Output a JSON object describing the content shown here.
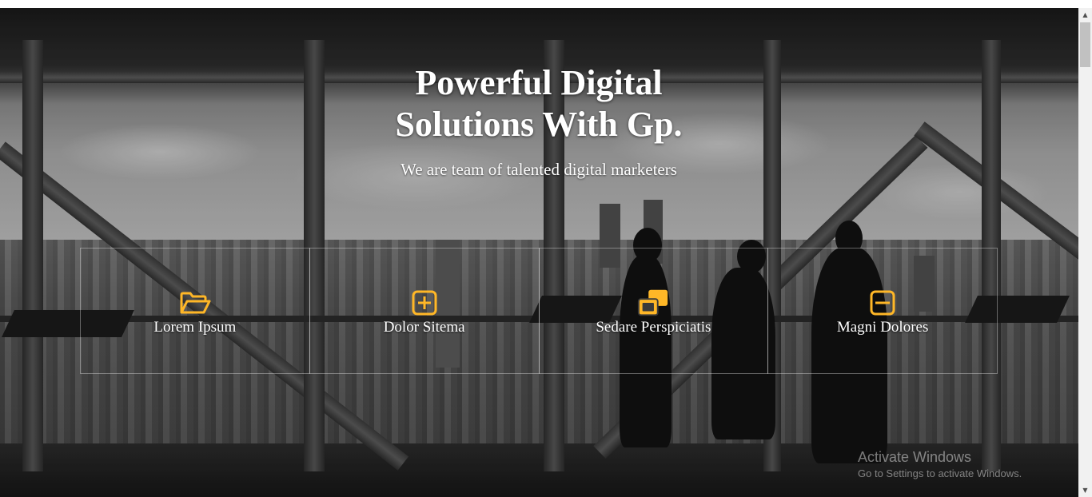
{
  "hero": {
    "title_line1": "Powerful Digital",
    "title_line2": "Solutions With Gp.",
    "subtitle": "We are team of talented digital marketers"
  },
  "features": [
    {
      "label": "Lorem Ipsum",
      "icon": "folder-open-icon"
    },
    {
      "label": "Dolor Sitema",
      "icon": "grid-plus-icon"
    },
    {
      "label": "Sedare Perspiciatis",
      "icon": "overlapping-squares-icon"
    },
    {
      "label": "Magni Dolores",
      "icon": "minus-square-icon"
    }
  ],
  "watermark": {
    "title": "Activate Windows",
    "subtitle": "Go to Settings to activate Windows."
  },
  "colors": {
    "accent": "#ffb727",
    "text": "#ffffff"
  }
}
